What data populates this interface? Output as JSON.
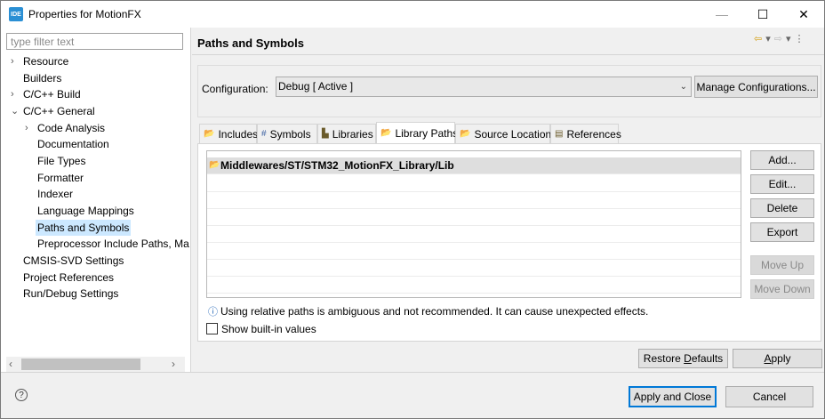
{
  "window": {
    "app_icon": "IDE",
    "title": "Properties for MotionFX",
    "minimize": "—",
    "maximize": "☐",
    "close": "✕"
  },
  "filter": {
    "placeholder": "type filter text"
  },
  "tree": [
    {
      "label": "Resource",
      "arrow": "›"
    },
    {
      "label": "Builders"
    },
    {
      "label": "C/C++ Build",
      "arrow": "›"
    },
    {
      "label": "C/C++ General",
      "arrow": "⌄"
    },
    {
      "label": "Code Analysis",
      "arrow": "›"
    },
    {
      "label": "Documentation"
    },
    {
      "label": "File Types"
    },
    {
      "label": "Formatter"
    },
    {
      "label": "Indexer"
    },
    {
      "label": "Language Mappings"
    },
    {
      "label": "Paths and Symbols"
    },
    {
      "label": "Preprocessor Include Paths, Ma"
    },
    {
      "label": "CMSIS-SVD Settings"
    },
    {
      "label": "Project References"
    },
    {
      "label": "Run/Debug Settings"
    }
  ],
  "scrollbar": {
    "left": "‹",
    "right": "›"
  },
  "header": {
    "title": "Paths and Symbols",
    "nav": {
      "back": "⇦",
      "back_menu": "▾",
      "forward": "⇨",
      "forward_menu": "▾",
      "more": "⋮"
    }
  },
  "configuration": {
    "label": "Configuration:",
    "value": "Debug  [ Active ]",
    "chevron": "⌄",
    "manage_button": "Manage Configurations..."
  },
  "tabs": [
    {
      "label": "Includes",
      "icon": "includes-icon",
      "glyph": "📂"
    },
    {
      "label": "Symbols",
      "icon": "hash-icon",
      "glyph": "#"
    },
    {
      "label": "Libraries",
      "icon": "libraries-icon",
      "glyph": "▙"
    },
    {
      "label": "Library Paths",
      "icon": "library-paths-icon",
      "glyph": "📂"
    },
    {
      "label": "Source Location",
      "icon": "source-location-icon",
      "glyph": "📂"
    },
    {
      "label": "References",
      "icon": "references-icon",
      "glyph": "▤"
    }
  ],
  "library_paths": [
    {
      "path": "Middlewares/ST/STM32_MotionFX_Library/Lib",
      "glyph": "📂"
    }
  ],
  "side_buttons": {
    "add": "Add...",
    "edit": "Edit...",
    "delete": "Delete",
    "export": "Export",
    "move_up": "Move Up",
    "move_down": "Move Down"
  },
  "info": {
    "glyph": "ⓘ",
    "text": "Using relative paths is ambiguous and not recommended. It can cause unexpected effects."
  },
  "show_builtin": {
    "label": "Show built-in values",
    "checked": false
  },
  "footer": {
    "restore_defaults_pre": "Restore ",
    "restore_defaults_ul": "D",
    "restore_defaults_post": "efaults",
    "apply_ul": "A",
    "apply_post": "pply",
    "help_glyph": "?",
    "apply_and_close": "Apply and Close",
    "cancel": "Cancel"
  },
  "colors": {
    "selection": "#cce8ff",
    "default_button_border": "#0078d7",
    "info_icon": "#1a5fb4"
  }
}
